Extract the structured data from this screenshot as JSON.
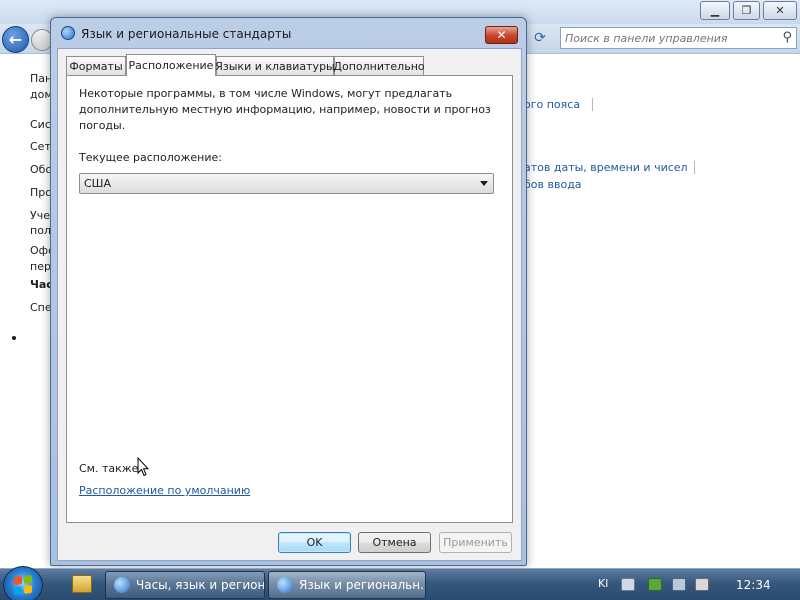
{
  "background_window": {
    "search_placeholder": "Поиск в панели управления",
    "left_nav": [
      "Пан",
      "дом",
      "Сис",
      "Сет",
      "Обо",
      "Про",
      "Уче",
      "пол",
      "Офо",
      "пер",
      "Час",
      "Спе"
    ],
    "right_links": [
      "ого пояса",
      "атов даты, времени и чисел",
      "бов ввода"
    ]
  },
  "dialog": {
    "title": "Язык и региональные стандарты",
    "tabs": [
      "Форматы",
      "Расположение",
      "Языки и клавиатуры",
      "Дополнительно"
    ],
    "active_tab": "Расположение",
    "description": "Некоторые программы, в том числе Windows, могут предлагать дополнительную местную информацию, например, новости и прогноз погоды.",
    "current_location_label": "Текущее расположение:",
    "current_location_value": "США",
    "see_also_label": "См. также",
    "default_location_link": "Расположение по умолчанию",
    "buttons": {
      "ok": "OK",
      "cancel": "Отмена",
      "apply": "Применить"
    }
  },
  "taskbar": {
    "buttons": [
      "Часы, язык и регион",
      "Язык и региональн..."
    ],
    "language_indicator": "Kl",
    "clock": "12:34"
  },
  "colors": {
    "link": "#1e5aa0",
    "close_button": "#c7432c",
    "taskbar": "#36587d"
  }
}
